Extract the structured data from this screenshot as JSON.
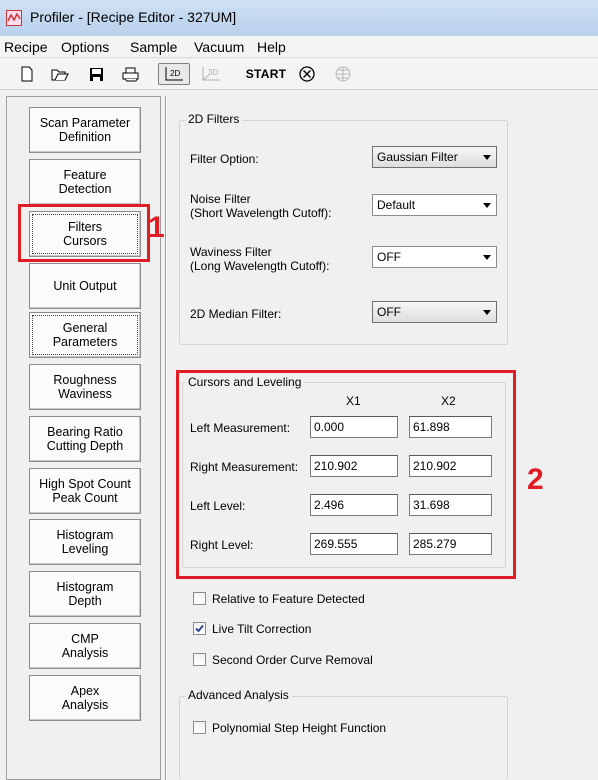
{
  "window": {
    "title": "Profiler - [Recipe Editor - 327UM]"
  },
  "menu": [
    "Recipe",
    "Options",
    "Sample",
    "Vacuum",
    "Help"
  ],
  "toolbar": {
    "btn_2d_label": "2D",
    "btn_3d_label": "3D",
    "start_label": "START",
    "icons": [
      "new-file-icon",
      "open-folder-icon",
      "save-icon",
      "print-icon",
      "2d-scan-icon",
      "3d-scan-icon",
      "stop-icon",
      "grid-icon"
    ]
  },
  "sidebar": {
    "buttons": [
      "Scan Parameter\nDefinition",
      "Feature\nDetection",
      "Filters\nCursors",
      "Unit Output",
      "General\nParameters",
      "Roughness\nWaviness",
      "Bearing Ratio\nCutting Depth",
      "High Spot Count\nPeak Count",
      "Histogram\nLeveling",
      "Histogram\nDepth",
      "CMP\nAnalysis",
      "Apex\nAnalysis"
    ],
    "active": "Filters\nCursors"
  },
  "filters2d": {
    "title": "2D Filters",
    "filter_option_label": "Filter Option:",
    "filter_option_value": "Gaussian Filter",
    "noise_label": "Noise Filter\n(Short Wavelength Cutoff):",
    "noise_value": "Default",
    "waviness_label": "Waviness Filter\n(Long Wavelength Cutoff):",
    "waviness_value": "OFF",
    "median_label": "2D Median Filter:",
    "median_value": "OFF"
  },
  "cursors": {
    "title": "Cursors and Leveling",
    "col_x1": "X1",
    "col_x2": "X2",
    "rows": [
      {
        "label": "Left Measurement:",
        "x1": "0.000",
        "x2": "61.898"
      },
      {
        "label": "Right Measurement:",
        "x1": "210.902",
        "x2": "210.902"
      },
      {
        "label": "Left Level:",
        "x1": "2.496",
        "x2": "31.698"
      },
      {
        "label": "Right Level:",
        "x1": "269.555",
        "x2": "285.279"
      }
    ]
  },
  "options": {
    "relative_label": "Relative to Feature Detected",
    "relative_checked": false,
    "tilt_label": "Live Tilt Correction",
    "tilt_checked": true,
    "second_order_label": "Second Order Curve Removal",
    "second_order_checked": false
  },
  "advanced": {
    "title": "Advanced Analysis",
    "poly_label": "Polynomial Step Height Function",
    "poly_checked": false
  },
  "annotations": {
    "one": "1",
    "two": "2",
    "color": "#e01c24"
  }
}
